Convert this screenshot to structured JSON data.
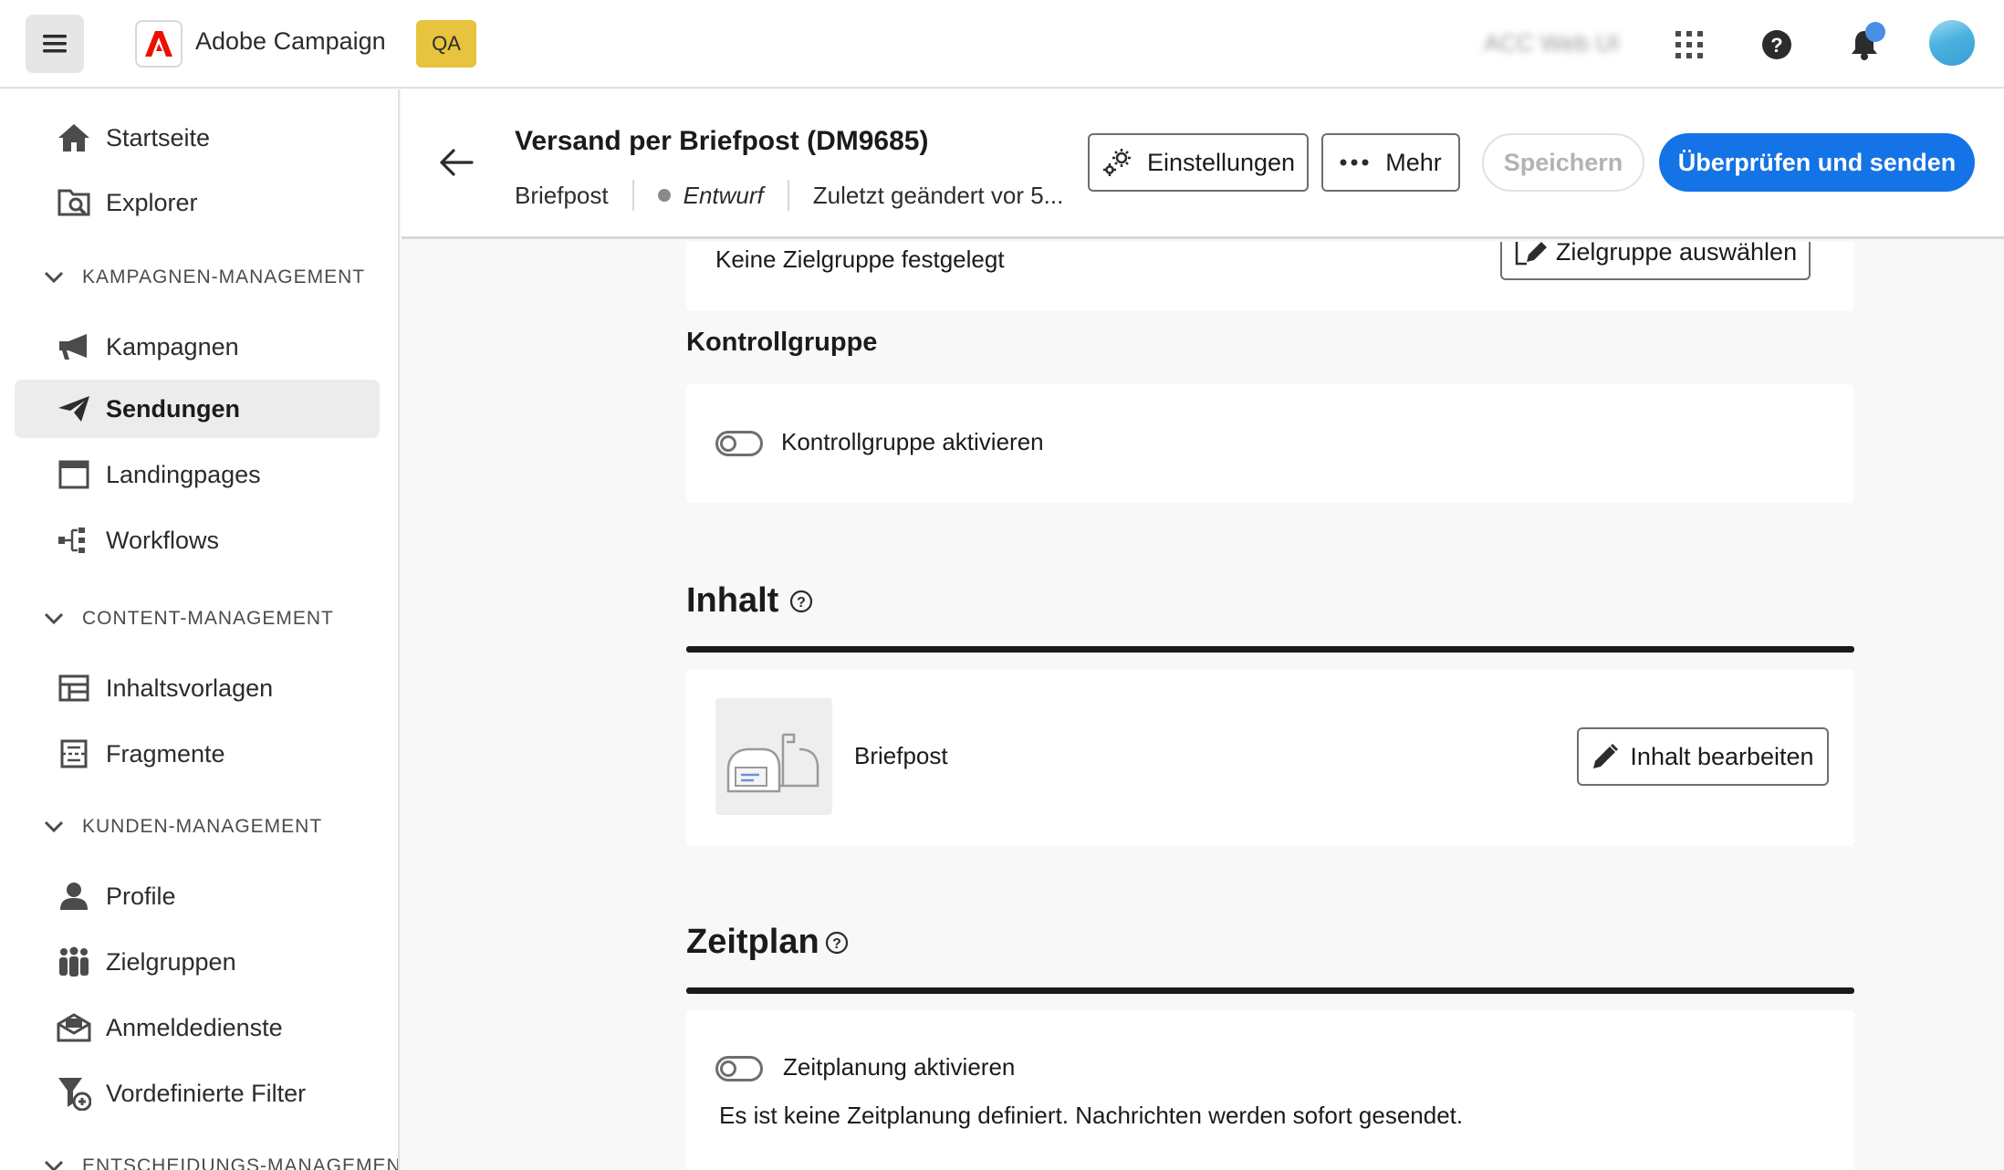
{
  "topbar": {
    "app_name": "Adobe Campaign",
    "env_badge": "QA",
    "org_name": "ACC Web UI",
    "icons": [
      "menu-icon",
      "adobe-logo-icon",
      "app-switcher-icon",
      "help-icon",
      "bell-icon",
      "avatar"
    ]
  },
  "sidebar": {
    "items_top": [
      {
        "label": "Startseite",
        "icon": "home-icon"
      },
      {
        "label": "Explorer",
        "icon": "explorer-icon"
      }
    ],
    "sections": [
      {
        "title": "KAMPAGNEN-MANAGEMENT",
        "items": [
          {
            "label": "Kampagnen",
            "icon": "megaphone-icon"
          },
          {
            "label": "Sendungen",
            "icon": "send-icon",
            "active": true
          },
          {
            "label": "Landingpages",
            "icon": "browser-icon"
          },
          {
            "label": "Workflows",
            "icon": "workflow-icon"
          }
        ]
      },
      {
        "title": "CONTENT-MANAGEMENT",
        "items": [
          {
            "label": "Inhaltsvorlagen",
            "icon": "template-icon"
          },
          {
            "label": "Fragmente",
            "icon": "fragment-icon"
          }
        ]
      },
      {
        "title": "KUNDEN-MANAGEMENT",
        "items": [
          {
            "label": "Profile",
            "icon": "user-icon"
          },
          {
            "label": "Zielgruppen",
            "icon": "audience-icon"
          },
          {
            "label": "Anmeldedienste",
            "icon": "mail-subscription-icon"
          },
          {
            "label": "Vordefinierte Filter",
            "icon": "filter-icon"
          }
        ]
      },
      {
        "title": "ENTSCHEIDUNGS-MANAGEMENT",
        "items": []
      }
    ]
  },
  "header": {
    "title": "Versand per Briefpost (DM9685)",
    "channel": "Briefpost",
    "status": "Entwurf",
    "modified": "Zuletzt geändert vor 5...",
    "buttons": {
      "settings": "Einstellungen",
      "more": "Mehr",
      "save": "Speichern",
      "review_send": "Überprüfen und senden"
    }
  },
  "main": {
    "audience": {
      "none_text": "Keine Zielgruppe festgelegt",
      "select_button": "Zielgruppe auswählen"
    },
    "control_group": {
      "title": "Kontrollgruppe",
      "toggle_label": "Kontrollgruppe aktivieren",
      "enabled": false
    },
    "content": {
      "title": "Inhalt",
      "item_label": "Briefpost",
      "edit_button": "Inhalt bearbeiten"
    },
    "schedule": {
      "title": "Zeitplan",
      "toggle_label": "Zeitplanung aktivieren",
      "enabled": false,
      "note": "Es ist keine Zeitplanung definiert. Nachrichten werden sofort gesendet."
    }
  },
  "colors": {
    "primary": "#1473e6",
    "env_badge": "#e8c33d",
    "notification": "#4a8ee6"
  }
}
